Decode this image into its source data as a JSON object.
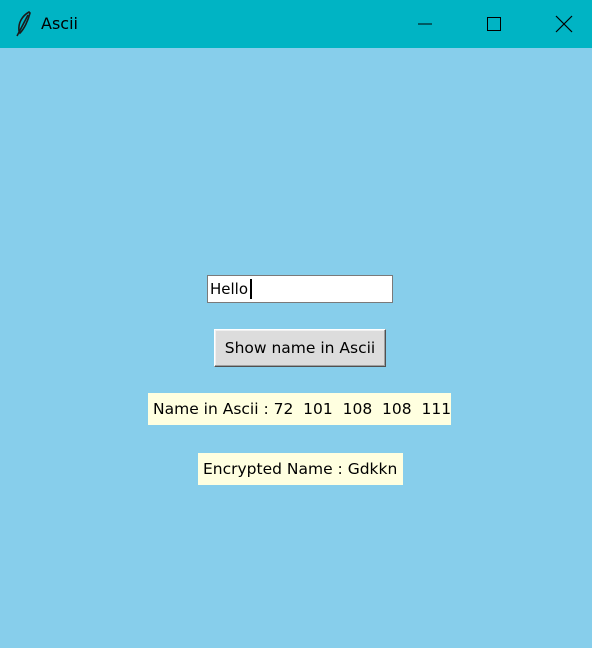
{
  "window": {
    "title": "Ascii",
    "icon": "feather-icon",
    "titlebar_color": "#00b4c4",
    "background_color": "#87ceeb",
    "controls": [
      "minimize-icon",
      "maximize-icon",
      "close-icon"
    ]
  },
  "form": {
    "name_value": "Hello",
    "button_label": "Show name in Ascii"
  },
  "results": {
    "ascii_text": "Name in Ascii : 72  101  108  108  111 ",
    "encrypted_text": "Encrypted Name : Gdkkn",
    "label_bg_color": "#ffffe0"
  }
}
